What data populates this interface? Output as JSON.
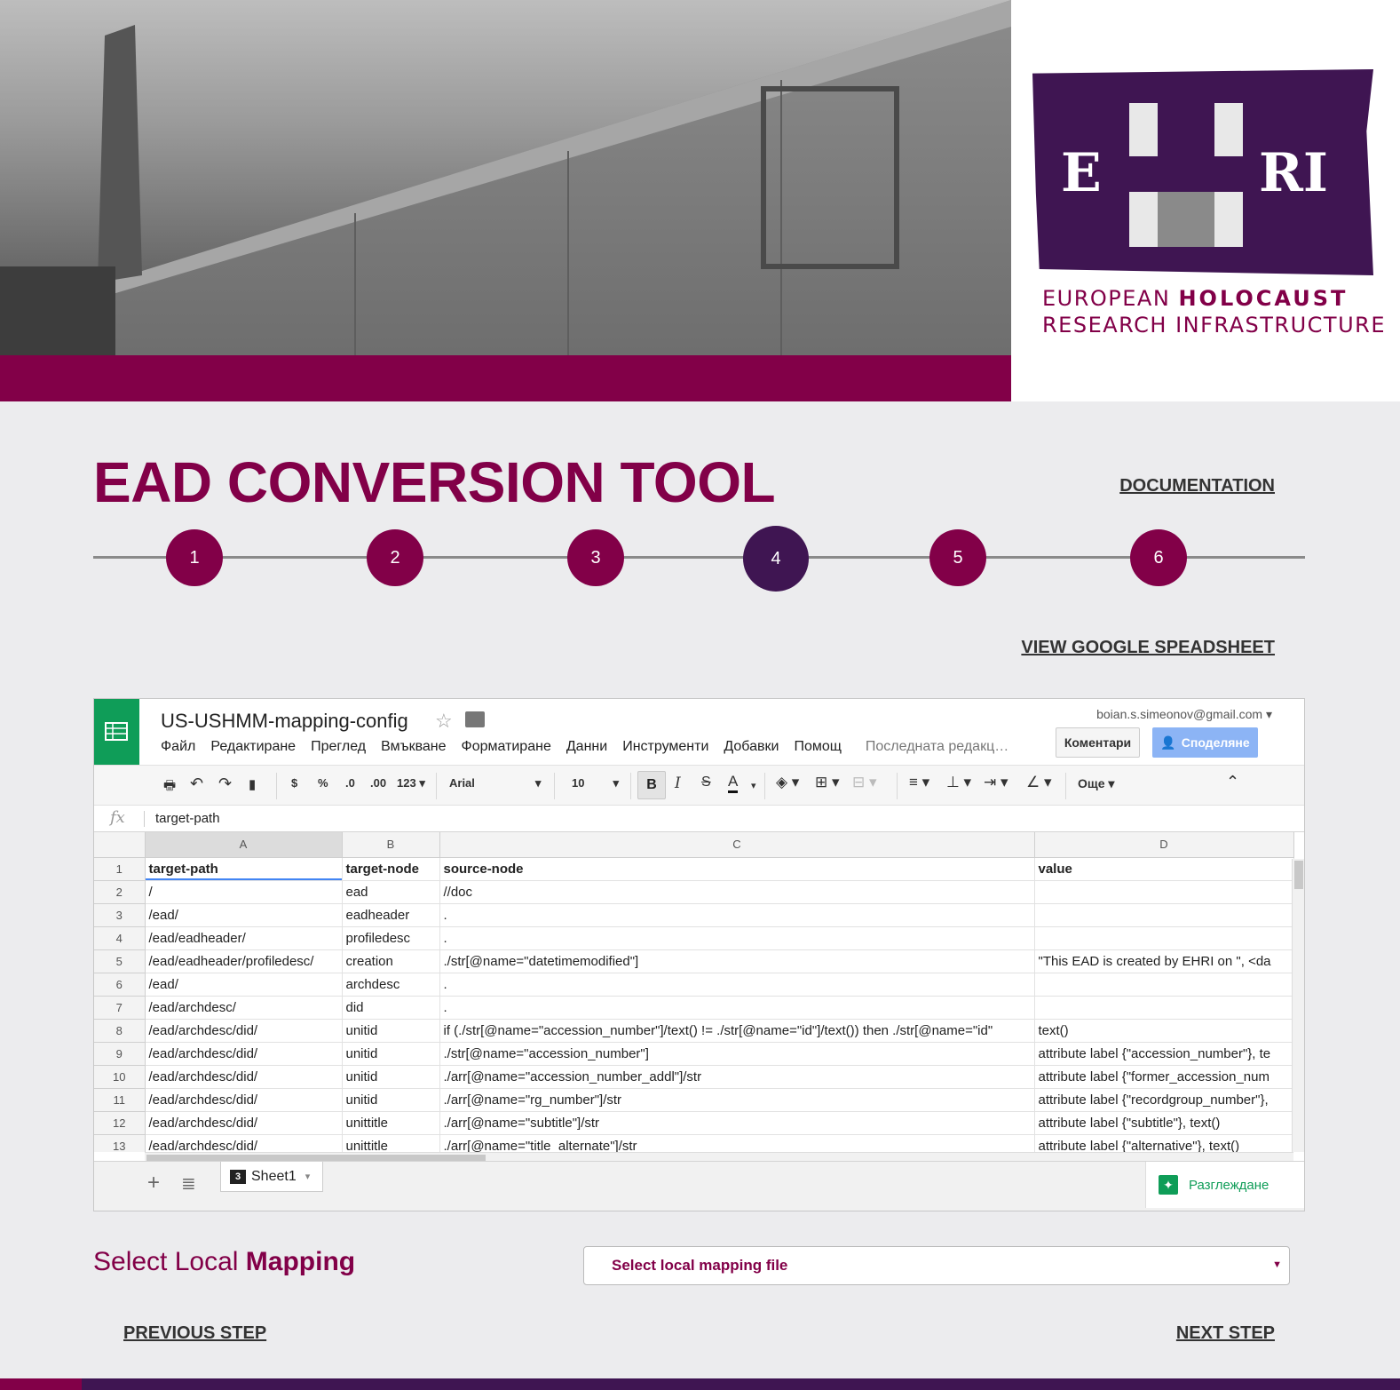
{
  "header": {
    "logo": {
      "letter_e": "E",
      "letter_ri": "RI",
      "line1_a": "EUROPEAN",
      "line1_b": "HOLOCAUST",
      "line2": "RESEARCH INFRASTRUCTURE"
    }
  },
  "page": {
    "title_light": "EAD",
    "title_bold": "CONVERSION TOOL",
    "documentation_link": "DOCUMENTATION",
    "view_sheet_link": "VIEW GOOGLE SPEADSHEET",
    "steps": [
      "1",
      "2",
      "3",
      "4",
      "5",
      "6"
    ],
    "active_step": "4"
  },
  "spreadsheet": {
    "title": "US-USHMM-mapping-config",
    "account": "boian.s.simeonov@gmail.com",
    "menu": [
      "Файл",
      "Редактиране",
      "Преглед",
      "Вмъкване",
      "Форматиране",
      "Данни",
      "Инструменти",
      "Добавки",
      "Помощ"
    ],
    "last_edit": "Последната редакц…",
    "comments_button": "Коментари",
    "share_button": "Споделяне",
    "toolbar": {
      "currency": "$",
      "percent": "%",
      "dec_less": ".0",
      "dec_more": ".00",
      "number_format": "123",
      "font": "Arial",
      "font_size": "10",
      "bold": "B",
      "italic": "I",
      "strike": "S",
      "text_color": "A",
      "more": "Още"
    },
    "formula_value": "target-path",
    "columns": [
      "A",
      "B",
      "C",
      "D"
    ],
    "rows": [
      [
        "1",
        "target-path",
        "target-node",
        "source-node",
        "value"
      ],
      [
        "2",
        "/",
        "ead",
        "//doc",
        ""
      ],
      [
        "3",
        "/ead/",
        "eadheader",
        ".",
        ""
      ],
      [
        "4",
        "/ead/eadheader/",
        "profiledesc",
        ".",
        ""
      ],
      [
        "5",
        "/ead/eadheader/profiledesc/",
        "creation",
        "./str[@name=\"datetimemodified\"]",
        "\"This EAD is created by EHRI on \", <da"
      ],
      [
        "6",
        "/ead/",
        "archdesc",
        ".",
        ""
      ],
      [
        "7",
        "/ead/archdesc/",
        "did",
        ".",
        ""
      ],
      [
        "8",
        "/ead/archdesc/did/",
        "unitid",
        "if (./str[@name=\"accession_number\"]/text() != ./str[@name=\"id\"]/text()) then ./str[@name=\"id\"",
        "text()"
      ],
      [
        "9",
        "/ead/archdesc/did/",
        "unitid",
        "./str[@name=\"accession_number\"]",
        "attribute label {\"accession_number\"}, te"
      ],
      [
        "10",
        "/ead/archdesc/did/",
        "unitid",
        "./arr[@name=\"accession_number_addl\"]/str",
        "attribute label {\"former_accession_num"
      ],
      [
        "11",
        "/ead/archdesc/did/",
        "unitid",
        "./arr[@name=\"rg_number\"]/str",
        "attribute label {\"recordgroup_number\"},"
      ],
      [
        "12",
        "/ead/archdesc/did/",
        "unittitle",
        "./arr[@name=\"subtitle\"]/str",
        "attribute label {\"subtitle\"}, text()"
      ],
      [
        "13",
        "/ead/archdesc/did/",
        "unittitle",
        "./arr[@name=\"title_alternate\"]/str",
        "attribute label {\"alternative\"}, text()"
      ]
    ],
    "sheet_tab_badge": "3",
    "sheet_tab": "Sheet1",
    "explore": "Разглеждане"
  },
  "mapping": {
    "label_light": "Select Local",
    "label_bold": "Mapping",
    "select_placeholder": "Select local mapping file"
  },
  "nav": {
    "previous": "PREVIOUS STEP",
    "next": "NEXT STEP"
  },
  "colors": {
    "brand": "#820048",
    "brand_dark": "#3f1552",
    "sheets_green": "#0f9d58"
  }
}
